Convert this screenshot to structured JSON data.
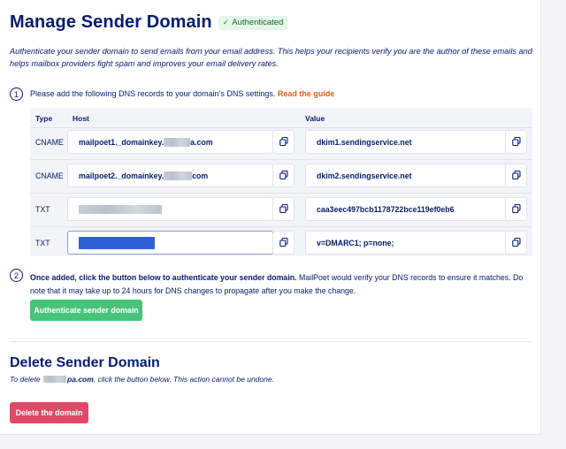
{
  "header": {
    "title": "Manage Sender Domain",
    "badge": "Authenticated",
    "badge_icon": "check-icon"
  },
  "intro": "Authenticate your sender domain to send emails from your email address. This helps your recipients verify you are the author of these emails and helps mailbox providers fight spam and improves your email delivery rates.",
  "step1": {
    "number": "1",
    "text": "Please add the following DNS records to your domain's DNS settings.",
    "link": "Read the guide"
  },
  "table": {
    "headers": {
      "type": "Type",
      "host": "Host",
      "value": "Value"
    },
    "rows": [
      {
        "type": "CNAME",
        "host_prefix": "mailpoet1._domainkey.",
        "host_suffix": "a.com",
        "value": "dkim1.sendingservice.net"
      },
      {
        "type": "CNAME",
        "host_prefix": "mailpoet2._domainkey.",
        "host_suffix": "com",
        "value": "dkim2.sendingservice.net"
      },
      {
        "type": "TXT",
        "host_prefix": "",
        "host_suffix": "",
        "value": "caa3eec497bcb1178722bce119ef0eb6"
      },
      {
        "type": "TXT",
        "host_prefix": "",
        "host_suffix": "",
        "value": "v=DMARC1; p=none;"
      }
    ],
    "copy_icon": "copy-icon"
  },
  "step2": {
    "number": "2",
    "bold": "Once added, click the button below to authenticate your sender domain.",
    "text": " MailPoet would verify your DNS records to ensure it matches. Do note that it may take up to 24 hours for DNS changes to propagate after you make the change."
  },
  "authenticate_button": "Authenticate sender domain",
  "delete": {
    "title": "Delete Sender Domain",
    "text_before": "To delete",
    "domain_suffix": "pa.com",
    "text_after": ", click the button below. This action cannot be undone.",
    "button": "Delete the domain"
  },
  "colors": {
    "primary_text": "#071c6d",
    "link_orange": "#e35f1c",
    "success_green": "#47c47a",
    "danger_red": "#e04a67",
    "selection_blue": "#2f5fd8"
  }
}
